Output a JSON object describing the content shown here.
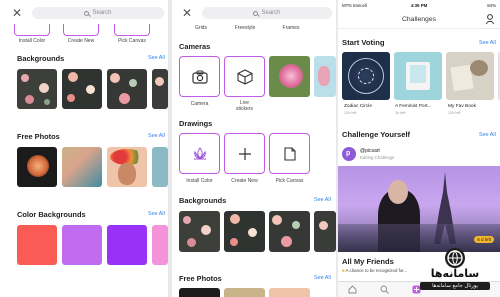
{
  "screen1": {
    "search_placeholder": "Search",
    "top_labels": [
      "Install Color",
      "Create New",
      "Pick Canvas"
    ],
    "backgrounds_title": "Backgrounds",
    "backgrounds_see_all": "See All",
    "free_photos_title": "Free Photos",
    "free_photos_see_all": "See All",
    "color_backgrounds_title": "Color Backgrounds",
    "color_backgrounds_see_all": "See All",
    "color_swatches": [
      "#fa5c55",
      "#c06bf0",
      "#9932f6",
      "#f493d9"
    ]
  },
  "screen2": {
    "search_placeholder": "Search",
    "top_labels": [
      "Grids",
      "Freestyle",
      "Frames"
    ],
    "cameras_title": "Cameras",
    "camera_labels": [
      "Camera",
      "Live\nstickers"
    ],
    "drawings_title": "Drawings",
    "drawing_labels": [
      "Install Color",
      "Create New",
      "Pick Canvas"
    ],
    "backgrounds_title": "Backgrounds",
    "backgrounds_see_all": "See All",
    "free_photos_title": "Free Photos",
    "free_photos_see_all": "See All"
  },
  "screen3": {
    "carrier": "MTN Irancell",
    "time": "4:39 PM",
    "battery": "84%",
    "nav_title": "Challenges",
    "start_voting_title": "Start Voting",
    "start_voting_see_all": "See All",
    "vote_items": [
      {
        "label": "Zodiac Circle",
        "sub": "12h left"
      },
      {
        "label": "A Feminist Port...",
        "sub": "1h left"
      },
      {
        "label": "My Fav Book",
        "sub": "12h left"
      }
    ],
    "challenge_title": "Challenge Yourself",
    "challenge_see_all": "See All",
    "challenge_user": "@picsart",
    "challenge_status": "Editing Challenge",
    "challenge_badge": "6 d left",
    "friends_title": "All My Friends",
    "friends_sub": "A chance to be recognized for..."
  },
  "watermark": {
    "brand": "سامانه‌ها",
    "sub": "پورتال جامع سامانه‌ها"
  },
  "colors": {
    "accent": "#c25be5",
    "link": "#2f80ed"
  }
}
